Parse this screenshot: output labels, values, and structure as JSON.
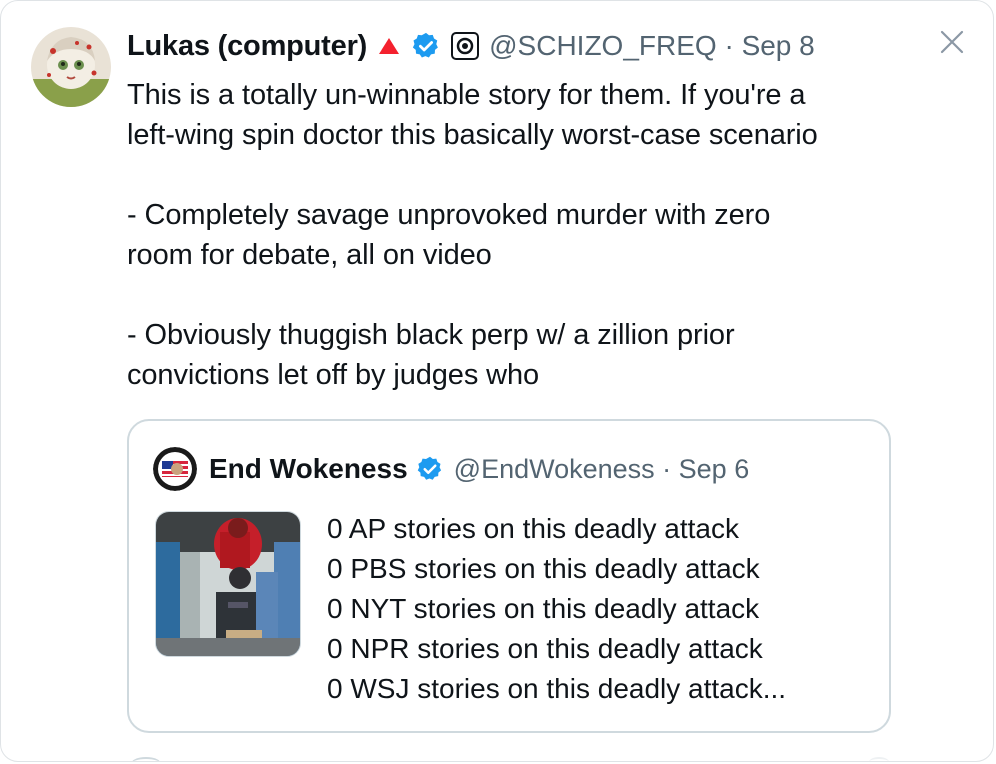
{
  "tweet": {
    "author": {
      "display_name": "Lukas (computer)",
      "handle_meta": "@SCHIZO_FREQ · Sep 8",
      "icons": [
        "red-triangle-icon",
        "verified-badge-icon",
        "circle-target-icon"
      ]
    },
    "text": {
      "line1": "This is a totally un-winnable story for them. If you're a",
      "line2": "left-wing spin doctor this basically worst-case scenario",
      "line3": "- Completely savage unprovoked murder with zero",
      "line4": "room for debate, all on video",
      "line5": "- Obviously thuggish black perp w/ a zillion prior",
      "line6": "convictions let off by judges who"
    },
    "close_icon": "close-icon"
  },
  "quote": {
    "author": {
      "display_name": "End Wokeness",
      "handle_meta": "@EndWokeness · Sep 6"
    },
    "lines": [
      "0 AP stories on this deadly attack",
      "0 PBS stories on this deadly attack",
      "0 NYT stories on this deadly attack",
      "0 NPR stories on this deadly attack",
      "0 WSJ stories on this deadly attack..."
    ]
  },
  "colors": {
    "text": "#0f1419",
    "muted": "#536471",
    "verified": "#1d9bf0",
    "triangle": "#f4212e",
    "border": "#cfd9de"
  }
}
